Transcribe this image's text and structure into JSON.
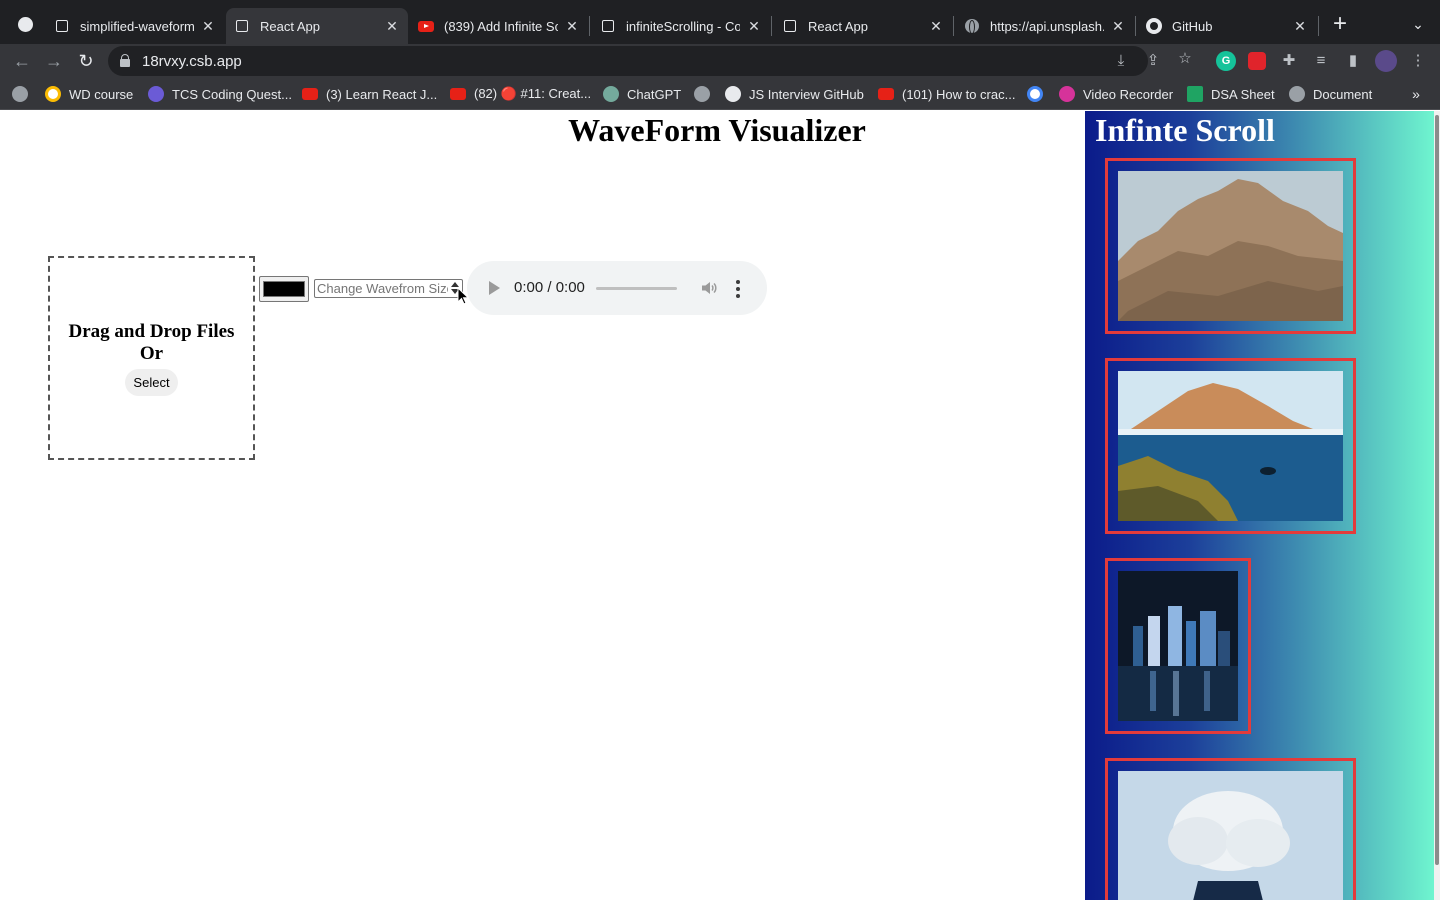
{
  "browser": {
    "tabs": [
      {
        "title": "simplified-waveform-",
        "favicon": "codesandbox-icon"
      },
      {
        "title": "React App",
        "favicon": "codesandbox-icon",
        "active": true
      },
      {
        "title": "(839) Add Infinite Sc",
        "favicon": "youtube-icon"
      },
      {
        "title": "infiniteScrolling - Co",
        "favicon": "codesandbox-icon"
      },
      {
        "title": "React App",
        "favicon": "codesandbox-icon"
      },
      {
        "title": "https://api.unsplash.",
        "favicon": "globe-icon"
      },
      {
        "title": "GitHub",
        "favicon": "github-icon"
      }
    ],
    "url": "18rvxy.csb.app",
    "bookmarks": [
      {
        "label": "",
        "icon": "globe-icon"
      },
      {
        "label": "WD course",
        "icon": "wd-icon"
      },
      {
        "label": "TCS Coding Quest...",
        "icon": "tcs-icon"
      },
      {
        "label": "(3) Learn React J...",
        "icon": "youtube-icon"
      },
      {
        "label": "(82) 🔴 #11: Creat...",
        "icon": "youtube-icon"
      },
      {
        "label": "ChatGPT",
        "icon": "chatgpt-icon"
      },
      {
        "label": "",
        "icon": "globe-icon"
      },
      {
        "label": "JS Interview GitHub",
        "icon": "github-icon"
      },
      {
        "label": "(101) How to crac...",
        "icon": "youtube-icon"
      },
      {
        "label": "",
        "icon": "google-icon"
      },
      {
        "label": "Video Recorder",
        "icon": "recorder-icon"
      },
      {
        "label": "DSA Sheet",
        "icon": "sheet-icon"
      },
      {
        "label": "Document",
        "icon": "globe-icon"
      }
    ]
  },
  "app": {
    "title": "WaveForm Visualizer",
    "dropzone": {
      "line1": "Drag and Drop Files",
      "line2": "Or",
      "select_label": "Select"
    },
    "color_value": "#000000",
    "size_placeholder": "Change Wavefrom Size",
    "audio": {
      "time": "0:00 / 0:00"
    }
  },
  "sidebar": {
    "title": "Infinte Scroll",
    "images": [
      {
        "alt": "rocky cliff with goats",
        "colors": [
          "#b9c9d2",
          "#a98e72"
        ]
      },
      {
        "alt": "island over reef with diver",
        "colors": [
          "#cfe3ef",
          "#1f5f8f"
        ]
      },
      {
        "alt": "city skyline at night",
        "colors": [
          "#0e1a2b",
          "#2a4a6d"
        ]
      },
      {
        "alt": "person with cloud head",
        "colors": [
          "#bcd4e6",
          "#e9eef2"
        ]
      }
    ]
  }
}
